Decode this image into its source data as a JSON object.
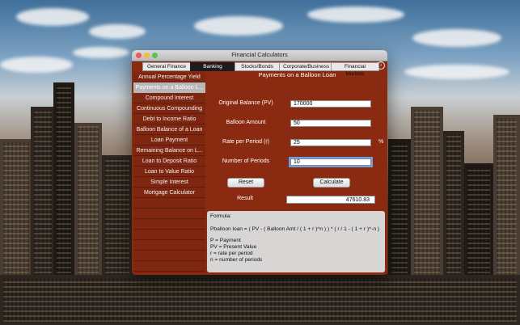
{
  "window": {
    "title": "Financial Calculators"
  },
  "tabs": [
    {
      "label": "General Finance",
      "active": false
    },
    {
      "label": "Banking",
      "active": true
    },
    {
      "label": "Stocks/Bonds",
      "active": false
    },
    {
      "label": "Corporate/Business",
      "active": false
    },
    {
      "label": "Financial Markets",
      "active": false
    }
  ],
  "info_icon": "i",
  "sidebar": {
    "items": [
      "Annual Percentage Yield",
      "Payments on a Balloon L...",
      "Compound Interest",
      "Continuous Compounding",
      "Debt to Income Ratio",
      "Balloon Balance of a Loan",
      "Loan Payment",
      "Remaining Balance on L...",
      "Loan to Deposit Ratio",
      "Loan to Value Ratio",
      "Simple Interest",
      "Mortgage Calculator"
    ],
    "selected_index": 1
  },
  "panel": {
    "title": "Payments on a Balloon Loan"
  },
  "fields": {
    "original_balance": {
      "label": "Original Balance (PV)",
      "value": "170000"
    },
    "balloon_amount": {
      "label": "Balloon Amount",
      "value": "50"
    },
    "rate_per_period": {
      "label": "Rate per Period (r)",
      "value": "25",
      "suffix": "%"
    },
    "number_of_periods": {
      "label": "Number of Periods",
      "value": "10"
    }
  },
  "buttons": {
    "reset": "Reset",
    "calculate": "Calculate"
  },
  "result": {
    "label": "Result",
    "value": "47610.83"
  },
  "formula": {
    "heading": "Formula:",
    "equation": "Pballoon loan = ( PV - ( Balloon Amt / ( 1 + r )^n ) ) * ( r / 1 - ( 1 + r )^-n )",
    "legend": [
      "P = Payment",
      "PV = Present Value",
      "r = rate per period",
      "n = number of periods"
    ]
  }
}
